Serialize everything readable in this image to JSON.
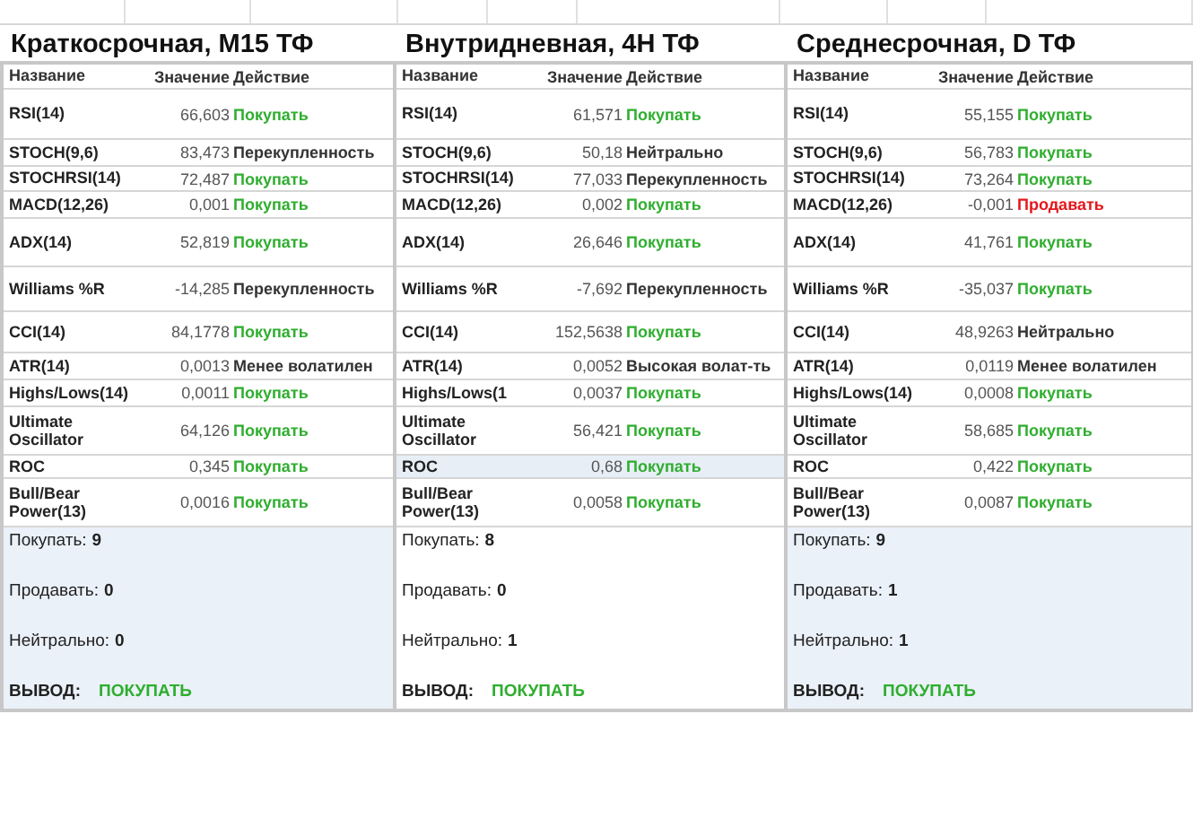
{
  "panels": [
    {
      "title": "Краткосрочная, M15 ТФ",
      "columns": [
        "Название",
        "Значение",
        "Действие"
      ],
      "rows": [
        {
          "name": "RSI(14)",
          "value": "66,603",
          "action": "Покупать",
          "color": "#2fae2f",
          "highlighted": false
        },
        {
          "name": "STOCH(9,6)",
          "value": "83,473",
          "action": "Перекупленность",
          "color": "#333333",
          "highlighted": false
        },
        {
          "name": "STOCHRSI(14)",
          "value": "72,487",
          "action": "Покупать",
          "color": "#2fae2f",
          "highlighted": false
        },
        {
          "name": "MACD(12,26)",
          "value": "0,001",
          "action": "Покупать",
          "color": "#2fae2f",
          "highlighted": false
        },
        {
          "name": "ADX(14)",
          "value": "52,819",
          "action": "Покупать",
          "color": "#2fae2f",
          "highlighted": false
        },
        {
          "name": "Williams %R",
          "value": "-14,285",
          "action": "Перекупленность",
          "color": "#333333",
          "highlighted": false
        },
        {
          "name": "CCI(14)",
          "value": "84,1778",
          "action": "Покупать",
          "color": "#2fae2f",
          "highlighted": false
        },
        {
          "name": "ATR(14)",
          "value": "0,0013",
          "action": "Менее волатилен",
          "color": "#333333",
          "highlighted": false
        },
        {
          "name": "Highs/Lows(14)",
          "value": "0,0011",
          "action": "Покупать",
          "color": "#2fae2f",
          "highlighted": false
        },
        {
          "name": "Ultimate Oscillator",
          "value": "64,126",
          "action": "Покупать",
          "color": "#2fae2f",
          "highlighted": false
        },
        {
          "name": "ROC",
          "value": "0,345",
          "action": "Покупать",
          "color": "#2fae2f",
          "highlighted": false
        },
        {
          "name": "Bull/Bear Power(13)",
          "value": "0,0016",
          "action": "Покупать",
          "color": "#2fae2f",
          "highlighted": false
        }
      ],
      "summary": {
        "shaded": true,
        "counts": [
          {
            "label": "Покупать:",
            "value": "9"
          },
          {
            "label": "Продавать:",
            "value": "0"
          },
          {
            "label": "Нейтрально:",
            "value": "0"
          }
        ],
        "conclusion_label": "ВЫВОД:",
        "conclusion": "ПОКУПАТЬ"
      }
    },
    {
      "title": "Внутридневная, 4H ТФ",
      "columns": [
        "Название",
        "Значение",
        "Действие"
      ],
      "rows": [
        {
          "name": "RSI(14)",
          "value": "61,571",
          "action": "Покупать",
          "color": "#2fae2f",
          "highlighted": false
        },
        {
          "name": "STOCH(9,6)",
          "value": "50,18",
          "action": "Нейтрально",
          "color": "#333333",
          "highlighted": false
        },
        {
          "name": "STOCHRSI(14)",
          "value": "77,033",
          "action": "Перекупленность",
          "color": "#333333",
          "highlighted": false
        },
        {
          "name": "MACD(12,26)",
          "value": "0,002",
          "action": "Покупать",
          "color": "#2fae2f",
          "highlighted": false
        },
        {
          "name": "ADX(14)",
          "value": "26,646",
          "action": "Покупать",
          "color": "#2fae2f",
          "highlighted": false
        },
        {
          "name": "Williams %R",
          "value": "-7,692",
          "action": "Перекупленность",
          "color": "#333333",
          "highlighted": false
        },
        {
          "name": "CCI(14)",
          "value": "152,5638",
          "action": "Покупать",
          "color": "#2fae2f",
          "highlighted": false
        },
        {
          "name": "ATR(14)",
          "value": "0,0052",
          "action": "Высокая волат-ть",
          "color": "#333333",
          "highlighted": false
        },
        {
          "name": "Highs/Lows(1",
          "value": "0,0037",
          "action": "Покупать",
          "color": "#2fae2f",
          "highlighted": false
        },
        {
          "name": "Ultimate Oscillator",
          "value": "56,421",
          "action": "Покупать",
          "color": "#2fae2f",
          "highlighted": false
        },
        {
          "name": "ROC",
          "value": "0,68",
          "action": "Покупать",
          "color": "#2fae2f",
          "highlighted": true
        },
        {
          "name": "Bull/Bear Power(13)",
          "value": "0,0058",
          "action": "Покупать",
          "color": "#2fae2f",
          "highlighted": false
        }
      ],
      "summary": {
        "shaded": false,
        "counts": [
          {
            "label": "Покупать:",
            "value": "8"
          },
          {
            "label": "Продавать:",
            "value": "0"
          },
          {
            "label": "Нейтрально:",
            "value": "1"
          }
        ],
        "conclusion_label": "ВЫВОД:",
        "conclusion": "ПОКУПАТЬ"
      }
    },
    {
      "title": "Среднесрочная, D ТФ",
      "columns": [
        "Название",
        "Значение",
        "Действие"
      ],
      "rows": [
        {
          "name": "RSI(14)",
          "value": "55,155",
          "action": "Покупать",
          "color": "#2fae2f",
          "highlighted": false
        },
        {
          "name": "STOCH(9,6)",
          "value": "56,783",
          "action": "Покупать",
          "color": "#2fae2f",
          "highlighted": false
        },
        {
          "name": "STOCHRSI(14)",
          "value": "73,264",
          "action": "Покупать",
          "color": "#2fae2f",
          "highlighted": false
        },
        {
          "name": "MACD(12,26)",
          "value": "-0,001",
          "action": "Продавать",
          "color": "#e5161c",
          "highlighted": false
        },
        {
          "name": "ADX(14)",
          "value": "41,761",
          "action": "Покупать",
          "color": "#2fae2f",
          "highlighted": false
        },
        {
          "name": "Williams %R",
          "value": "-35,037",
          "action": "Покупать",
          "color": "#2fae2f",
          "highlighted": false
        },
        {
          "name": "CCI(14)",
          "value": "48,9263",
          "action": "Нейтрально",
          "color": "#333333",
          "highlighted": false
        },
        {
          "name": "ATR(14)",
          "value": "0,0119",
          "action": "Менее волатилен",
          "color": "#333333",
          "highlighted": false
        },
        {
          "name": "Highs/Lows(14)",
          "value": "0,0008",
          "action": "Покупать",
          "color": "#2fae2f",
          "highlighted": false
        },
        {
          "name": "Ultimate Oscillator",
          "value": "58,685",
          "action": "Покупать",
          "color": "#2fae2f",
          "highlighted": false
        },
        {
          "name": "ROC",
          "value": "0,422",
          "action": "Покупать",
          "color": "#2fae2f",
          "highlighted": false
        },
        {
          "name": "Bull/Bear Power(13)",
          "value": "0,0087",
          "action": "Покупать",
          "color": "#2fae2f",
          "highlighted": false
        }
      ],
      "summary": {
        "shaded": true,
        "counts": [
          {
            "label": "Покупать:",
            "value": "9"
          },
          {
            "label": "Продавать:",
            "value": "1"
          },
          {
            "label": "Нейтрально:",
            "value": "1"
          }
        ],
        "conclusion_label": "ВЫВОД:",
        "conclusion": "ПОКУПАТЬ"
      }
    }
  ]
}
